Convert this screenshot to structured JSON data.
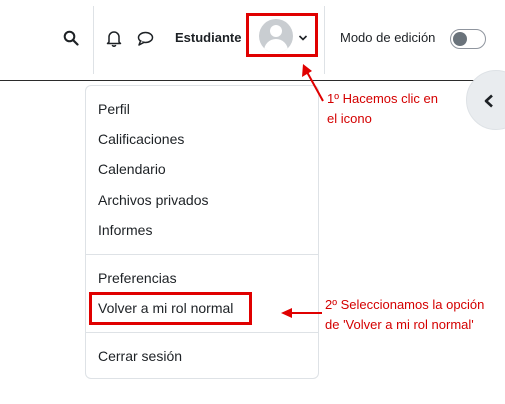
{
  "navbar": {
    "username": "Estudiante",
    "edit_mode_label": "Modo de edición",
    "edit_mode_on": false,
    "icons": [
      "search-icon",
      "bell-icon",
      "chat-icon",
      "avatar",
      "chevron-down-icon",
      "chevron-left-icon"
    ]
  },
  "user_menu": {
    "items": [
      "Perfil",
      "Calificaciones",
      "Calendario",
      "Archivos privados",
      "Informes"
    ],
    "items2": [
      "Preferencias",
      "Volver a mi rol normal"
    ],
    "items3": [
      "Cerrar sesión"
    ]
  },
  "annotations": {
    "step1_line1": "1º Hacemos clic en",
    "step1_line2": "el icono",
    "step2_line1": "2º Seleccionamos la opción",
    "step2_line2": "de 'Volver a mi rol normal'"
  },
  "colors": {
    "annotation": "#d40000",
    "highlight_border": "#e00000"
  }
}
